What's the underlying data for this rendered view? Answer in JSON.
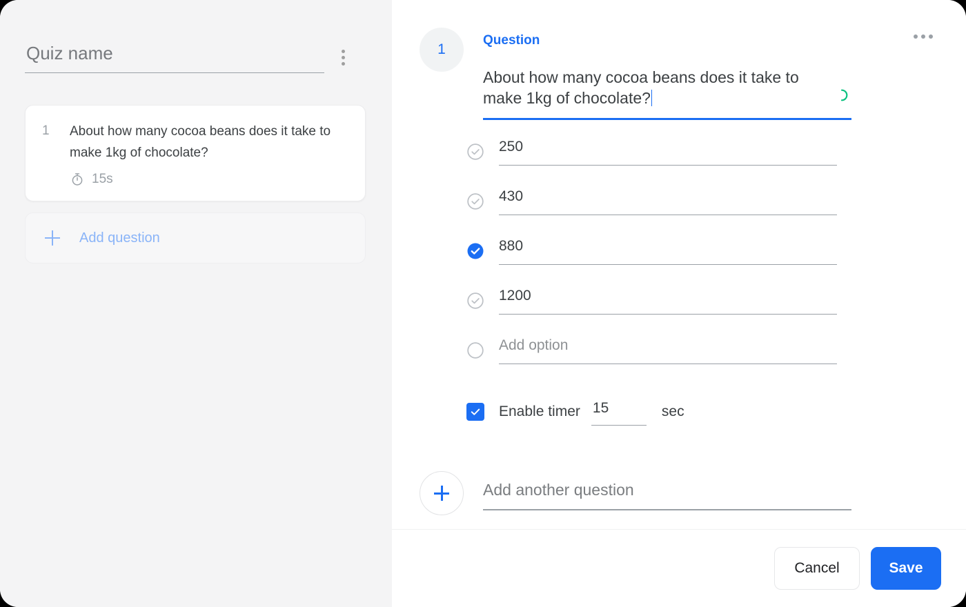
{
  "sidebar": {
    "quiz_name_placeholder": "Quiz name",
    "quiz_name_value": "",
    "menu_icon": "kebab-vertical-icon",
    "questions": [
      {
        "number": "1",
        "text": "About how many cocoa beans does it take to make 1kg of chocolate?",
        "timer_icon": "stopwatch-icon",
        "timer_label": "15s"
      }
    ],
    "add_question_label": "Add question",
    "add_question_icon": "plus-icon"
  },
  "editor": {
    "question_number": "1",
    "section_title": "Question",
    "more_menu_icon": "kebab-horizontal-icon",
    "question_text": "About how many cocoa beans does it take to make 1kg of chocolate?",
    "saving_indicator_icon": "spinner-icon",
    "options": [
      {
        "label": "250",
        "selected": false,
        "icon": "check-circle-outline-icon"
      },
      {
        "label": "430",
        "selected": false,
        "icon": "check-circle-outline-icon"
      },
      {
        "label": "880",
        "selected": true,
        "icon": "check-circle-filled-icon"
      },
      {
        "label": "1200",
        "selected": false,
        "icon": "check-circle-outline-icon"
      }
    ],
    "add_option_placeholder": "Add option",
    "add_option_icon": "empty-circle-icon",
    "timer": {
      "enabled": true,
      "checkbox_icon": "checkbox-checked-icon",
      "label": "Enable timer",
      "value": "15",
      "unit": "sec"
    },
    "add_another_question_placeholder": "Add another question",
    "add_another_question_icon": "plus-icon"
  },
  "footer": {
    "cancel_label": "Cancel",
    "save_label": "Save"
  },
  "colors": {
    "accent_blue": "#1b6ef3",
    "muted_blue": "#8ab4f8",
    "sidebar_bg": "#f4f4f5",
    "panel_bg": "#ffffff",
    "text_primary": "#3c4043",
    "text_muted": "#9aa0a6",
    "spinner_green": "#0bc17f"
  }
}
